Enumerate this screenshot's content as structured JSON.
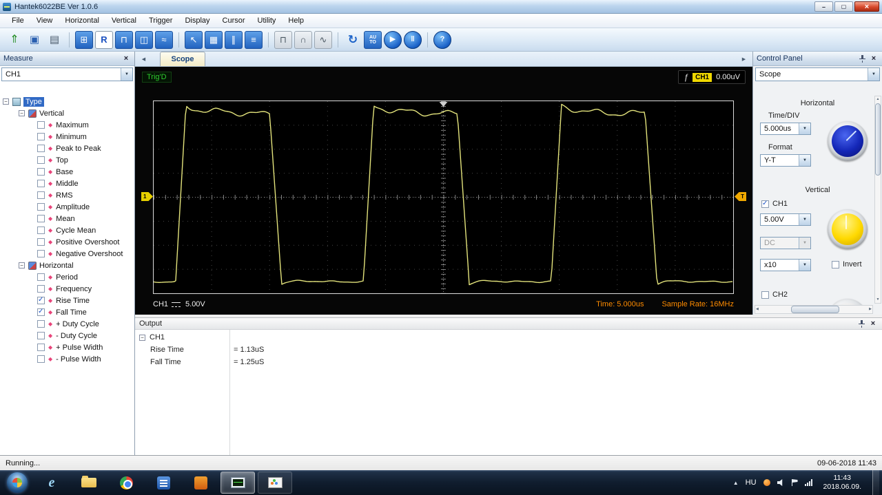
{
  "window": {
    "title": "Hantek6022BE Ver 1.0.6",
    "controls": {
      "minimize": "minimize",
      "maximize": "maximize",
      "close": "close"
    }
  },
  "menu": {
    "items": [
      "File",
      "View",
      "Horizontal",
      "Vertical",
      "Trigger",
      "Display",
      "Cursor",
      "Utility",
      "Help"
    ]
  },
  "toolbar": {
    "items": [
      {
        "name": "open",
        "glyph": "⇑",
        "cls": "g-green"
      },
      {
        "name": "save",
        "glyph": "▣",
        "cls": "g-blue"
      },
      {
        "name": "print",
        "glyph": "▤",
        "cls": "g-gray"
      },
      {
        "sep": true
      },
      {
        "name": "general-settings",
        "glyph": "⊞",
        "cls": "tile-blue"
      },
      {
        "name": "reference",
        "glyph": "R",
        "cls": "tile-white"
      },
      {
        "name": "display-square",
        "glyph": "⊓",
        "cls": "tile-blue"
      },
      {
        "name": "display-split",
        "glyph": "◫",
        "cls": "tile-blue"
      },
      {
        "name": "display-wave",
        "glyph": "≈",
        "cls": "tile-blue"
      },
      {
        "sep": true
      },
      {
        "name": "cursor-pointer",
        "glyph": "↖",
        "cls": "tile-blue"
      },
      {
        "name": "cursor-grid",
        "glyph": "▦",
        "cls": "tile-blue"
      },
      {
        "name": "cursor-vertical",
        "glyph": "∥",
        "cls": "tile-blue"
      },
      {
        "name": "cursor-horizontal",
        "glyph": "≡",
        "cls": "tile-blue"
      },
      {
        "sep": true
      },
      {
        "name": "interp-step",
        "glyph": "⊓",
        "cls": "tile-gray"
      },
      {
        "name": "interp-linear",
        "glyph": "∩",
        "cls": "tile-gray"
      },
      {
        "name": "interp-sine",
        "glyph": "∿",
        "cls": "tile-gray"
      },
      {
        "sep": true
      },
      {
        "name": "refresh",
        "glyph": "↻",
        "cls": "g-accent"
      },
      {
        "name": "autoset",
        "glyph": "AU TO",
        "cls": "tile-blue auto-tile"
      },
      {
        "name": "start",
        "glyph": "▶",
        "cls": "circle-blue"
      },
      {
        "name": "pause",
        "glyph": "‖",
        "cls": "circle-blue"
      },
      {
        "sep": true
      },
      {
        "name": "help",
        "glyph": "?",
        "cls": "circle-blue"
      }
    ]
  },
  "measure": {
    "title": "Measure",
    "channel": "CH1",
    "root": "Type",
    "groups": [
      {
        "label": "Vertical",
        "items": [
          {
            "label": "Maximum",
            "checked": false
          },
          {
            "label": "Minimum",
            "checked": false
          },
          {
            "label": "Peak to Peak",
            "checked": false
          },
          {
            "label": "Top",
            "checked": false
          },
          {
            "label": "Base",
            "checked": false
          },
          {
            "label": "Middle",
            "checked": false
          },
          {
            "label": "RMS",
            "checked": false
          },
          {
            "label": "Amplitude",
            "checked": false
          },
          {
            "label": "Mean",
            "checked": false
          },
          {
            "label": "Cycle Mean",
            "checked": false
          },
          {
            "label": "Positive Overshoot",
            "checked": false
          },
          {
            "label": "Negative Overshoot",
            "checked": false
          }
        ]
      },
      {
        "label": "Horizontal",
        "items": [
          {
            "label": "Period",
            "checked": false
          },
          {
            "label": "Frequency",
            "checked": false
          },
          {
            "label": "Rise Time",
            "checked": true
          },
          {
            "label": "Fall Time",
            "checked": true
          },
          {
            "label": "+ Duty Cycle",
            "checked": false
          },
          {
            "label": "- Duty Cycle",
            "checked": false
          },
          {
            "label": "+ Pulse Width",
            "checked": false
          },
          {
            "label": "- Pulse Width",
            "checked": false
          }
        ]
      }
    ]
  },
  "scope": {
    "tab": "Scope",
    "trig_status": "Trig'D",
    "trigger_icon": "ƒ",
    "channel_badge": "CH1",
    "trigger_level": "0.00uV",
    "left_marker": "1",
    "right_marker": "T",
    "channel_label": "CH1",
    "volts_div": "5.00V",
    "time_label": "Time: 5.000us",
    "sample_rate": "Sample Rate: 16MHz",
    "trace_color": "#e4e47c",
    "colors": {
      "ch1_badge": "#f0d800",
      "trigger_marker": "#f0a800",
      "status_ok": "#2ecc2e",
      "time_readout": "#ff8c00"
    },
    "waveform": {
      "period_div": 3.24,
      "first_rise_div": 0.38,
      "high_div": 3.55,
      "low_div": -3.5,
      "edge_div": 0.17,
      "high_frac": 0.5
    }
  },
  "control": {
    "title": "Control Panel",
    "mode": "Scope",
    "horizontal_label": "Horizontal",
    "timediv_label": "Time/DIV",
    "timediv": "5.000us",
    "format_label": "Format",
    "format": "Y-T",
    "vertical_label": "Vertical",
    "ch1": "CH1",
    "volts": "5.00V",
    "coupling": "DC",
    "probe": "x10",
    "invert": "Invert",
    "ch2": "CH2"
  },
  "output": {
    "title": "Output",
    "group": "CH1",
    "rows": [
      {
        "label": "Rise Time",
        "value": "= 1.13uS"
      },
      {
        "label": "Fall Time",
        "value": "= 1.25uS"
      }
    ]
  },
  "status": {
    "left": "Running...",
    "right": "09-06-2018 11:43"
  },
  "taskbar": {
    "language": "HU",
    "time": "11:43",
    "date": "2018.06.09."
  }
}
